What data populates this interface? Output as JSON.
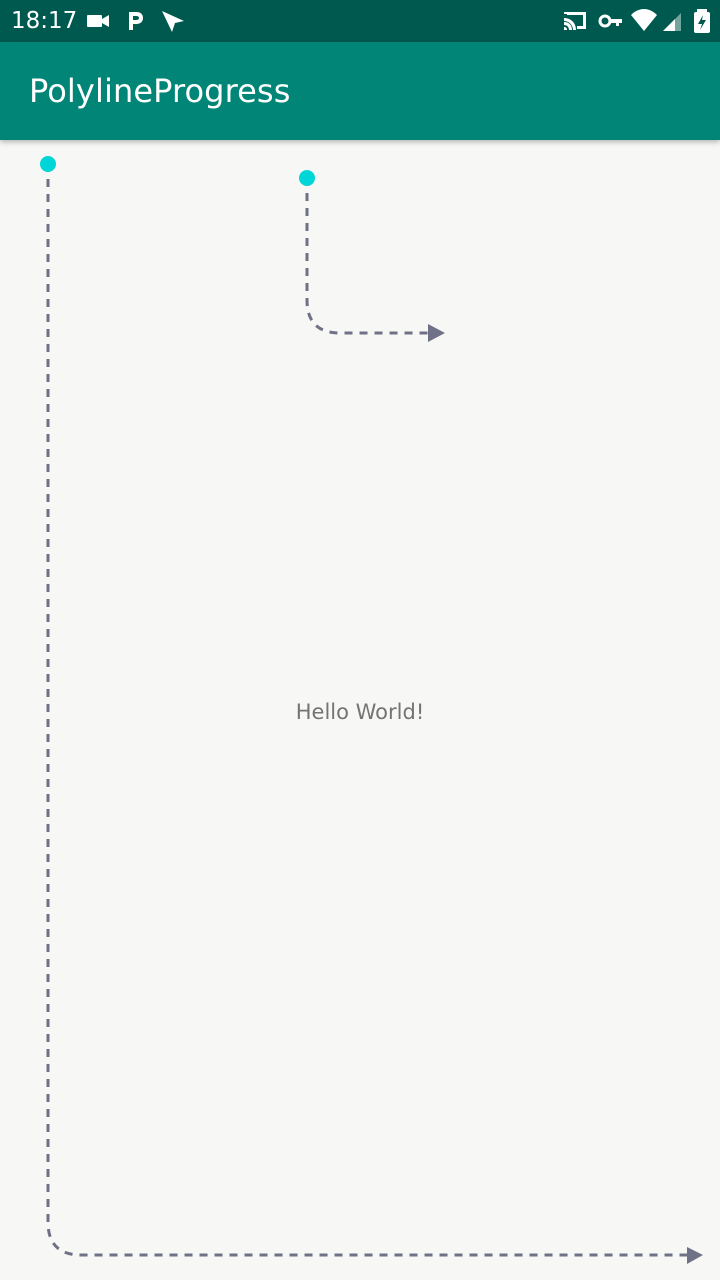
{
  "status_bar": {
    "time": "18:17",
    "background": "#00594f",
    "icons": [
      "video-camera-icon",
      "parking-icon",
      "navigation-icon",
      "cast-icon",
      "key-icon",
      "wifi-icon",
      "cellular-signal-icon",
      "battery-charging-icon"
    ]
  },
  "app_bar": {
    "title": "PolylineProgress",
    "background": "#008577"
  },
  "main": {
    "message": "Hello World!",
    "background": "#f7f7f5"
  },
  "polylines": {
    "line_color": "#6f7286",
    "marker_color": "#00d5d7",
    "items": [
      "short-polyline-progress",
      "full-height-polyline-progress"
    ]
  }
}
